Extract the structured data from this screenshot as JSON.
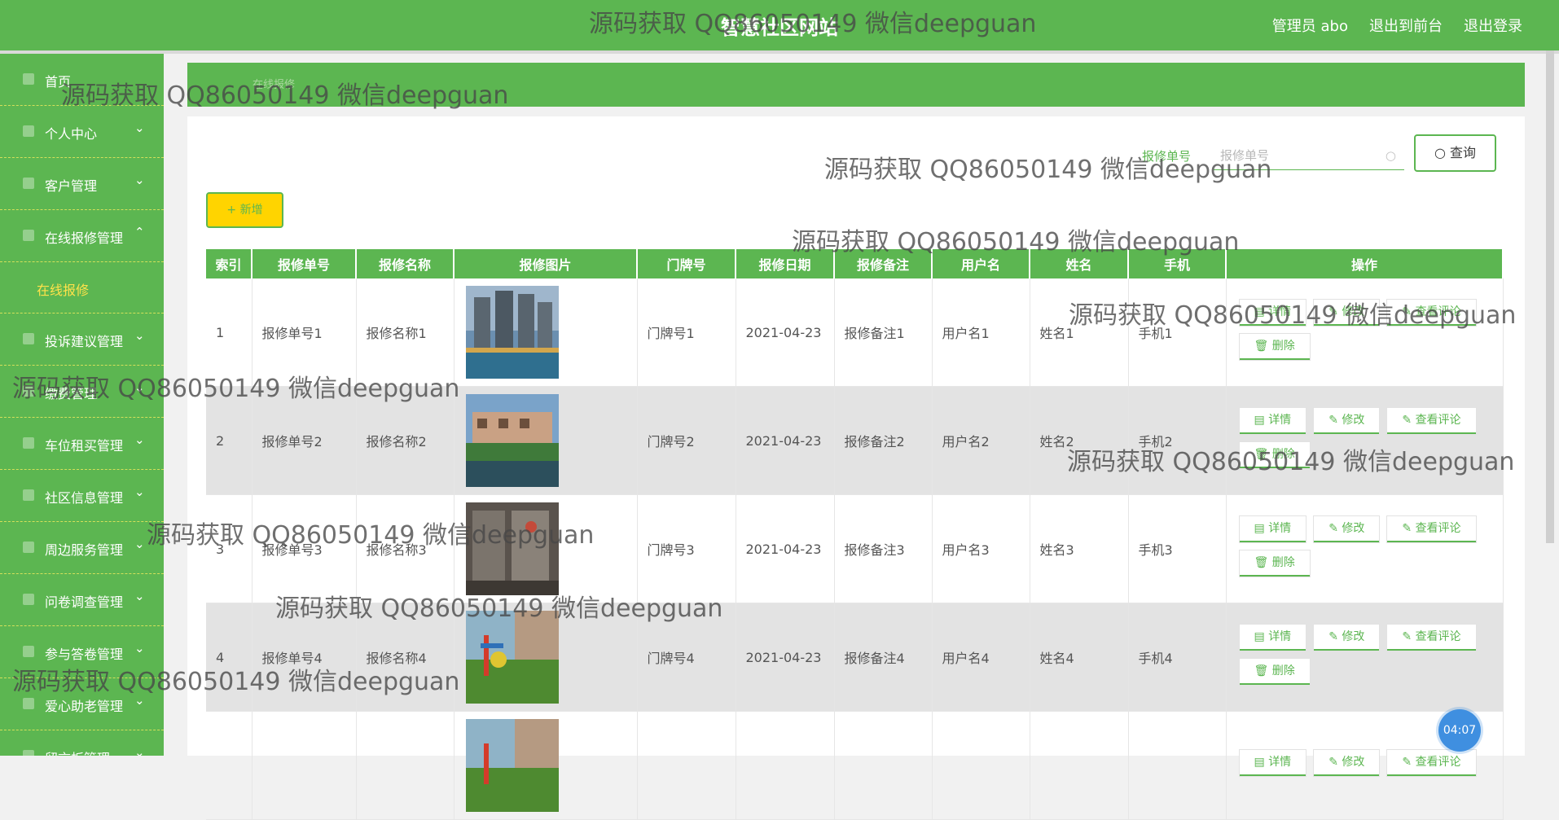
{
  "header": {
    "title": "智慧社区网站",
    "admin_label": "管理员 abo",
    "back_front": "退出到前台",
    "logout": "退出登录"
  },
  "sidebar": {
    "items": [
      {
        "label": "首页",
        "icon": "home-icon"
      },
      {
        "label": "个人中心",
        "icon": "user-icon",
        "chevron": "⌄"
      },
      {
        "label": "客户管理",
        "icon": "list-icon",
        "chevron": "⌄"
      },
      {
        "label": "在线报修管理",
        "icon": "grid-icon",
        "chevron": "⌃"
      },
      {
        "label": "投诉建议管理",
        "icon": "flag-icon",
        "chevron": "⌄"
      },
      {
        "label": "缴费管理",
        "icon": "wallet-icon",
        "chevron": "⌄"
      },
      {
        "label": "车位租买管理",
        "icon": "car-icon",
        "chevron": "⌄"
      },
      {
        "label": "社区信息管理",
        "icon": "info-icon",
        "chevron": "⌄"
      },
      {
        "label": "周边服务管理",
        "icon": "service-icon",
        "chevron": "⌄"
      },
      {
        "label": "问卷调查管理",
        "icon": "chart-icon",
        "chevron": "⌄"
      },
      {
        "label": "参与答卷管理",
        "icon": "form-icon",
        "chevron": "⌄"
      },
      {
        "label": "爱心助老管理",
        "icon": "heart-icon",
        "chevron": "⌄"
      },
      {
        "label": "留言板管理",
        "icon": "message-icon",
        "chevron": "⌄"
      }
    ],
    "sub_item": "在线报修"
  },
  "breadcrumb": "在线报修",
  "search": {
    "label": "报修单号",
    "placeholder": "报修单号",
    "button": "查询"
  },
  "add_button": "新增",
  "table": {
    "columns": [
      "索引",
      "报修单号",
      "报修名称",
      "报修图片",
      "门牌号",
      "报修日期",
      "报修备注",
      "用户名",
      "姓名",
      "手机",
      "操作"
    ],
    "rows": [
      {
        "index": "1",
        "no": "报修单号1",
        "name": "报修名称1",
        "door": "门牌号1",
        "date": "2021-04-23",
        "note": "报修备注1",
        "user": "用户名1",
        "realname": "姓名1",
        "phone": "手机1"
      },
      {
        "index": "2",
        "no": "报修单号2",
        "name": "报修名称2",
        "door": "门牌号2",
        "date": "2021-04-23",
        "note": "报修备注2",
        "user": "用户名2",
        "realname": "姓名2",
        "phone": "手机2"
      },
      {
        "index": "3",
        "no": "报修单号3",
        "name": "报修名称3",
        "door": "门牌号3",
        "date": "2021-04-23",
        "note": "报修备注3",
        "user": "用户名3",
        "realname": "姓名3",
        "phone": "手机3"
      },
      {
        "index": "4",
        "no": "报修单号4",
        "name": "报修名称4",
        "door": "门牌号4",
        "date": "2021-04-23",
        "note": "报修备注4",
        "user": "用户名4",
        "realname": "姓名4",
        "phone": "手机4"
      },
      {
        "index": "",
        "no": "",
        "name": "",
        "door": "",
        "date": "",
        "note": "",
        "user": "",
        "realname": "",
        "phone": ""
      }
    ],
    "ops": {
      "detail": "详情",
      "edit": "修改",
      "comments": "查看评论",
      "delete": "删除"
    }
  },
  "timer": "04:07",
  "watermark": "源码获取 QQ86050149 微信deepguan",
  "colors": {
    "primary": "#5cb651",
    "add_button": "#ffd400",
    "timer": "#3f8fe0"
  }
}
